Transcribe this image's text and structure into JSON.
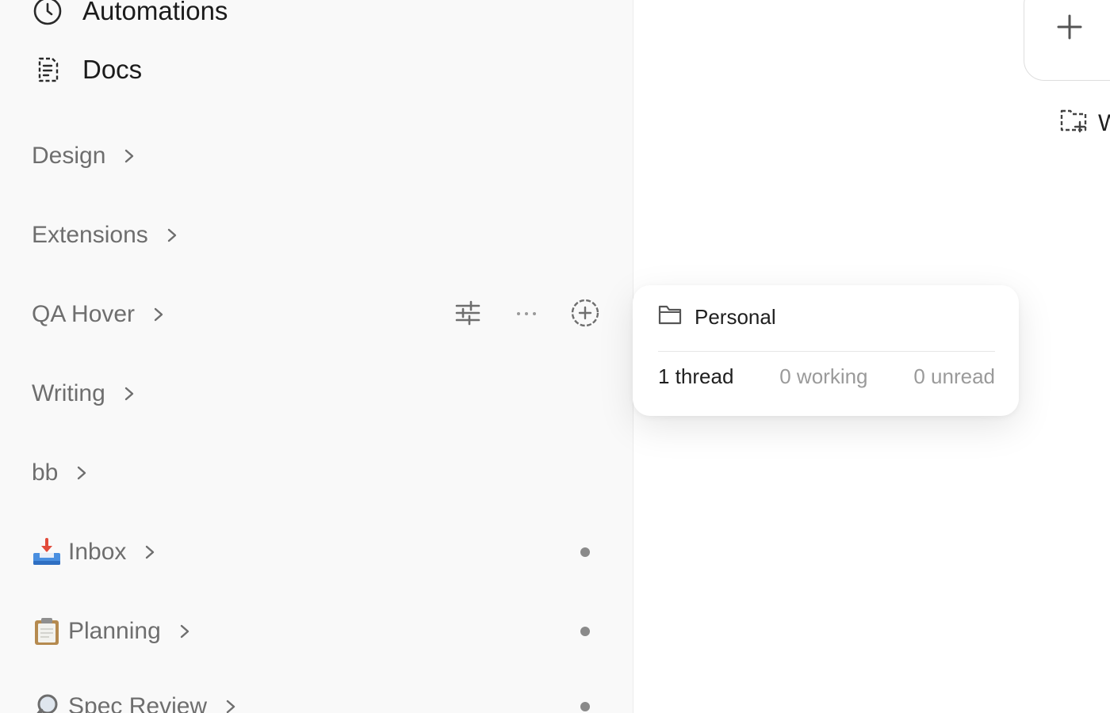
{
  "sidebar": {
    "nav": [
      {
        "label": "Automations",
        "icon": "clock-icon"
      },
      {
        "label": "Docs",
        "icon": "docs-icon"
      }
    ],
    "groups": [
      {
        "label": "Design"
      },
      {
        "label": "Extensions"
      },
      {
        "label": "QA Hover"
      },
      {
        "label": "Writing"
      },
      {
        "label": "bb"
      },
      {
        "label": "Inbox",
        "emoji": "inbox-tray-icon"
      },
      {
        "label": "Planning",
        "emoji": "clipboard-icon"
      },
      {
        "label": "Spec Review",
        "emoji": "magnifier-icon"
      }
    ]
  },
  "main": {
    "new_folder_label": "W"
  },
  "tooltip": {
    "title": "Personal",
    "threads": "1 thread",
    "working": "0 working",
    "unread": "0 unread"
  },
  "colors": {
    "sidebar_bg": "#f9f9f9",
    "muted_text": "#6e6e6e",
    "stat_muted": "#9a9a9a",
    "dot": "#8a8a8a"
  }
}
